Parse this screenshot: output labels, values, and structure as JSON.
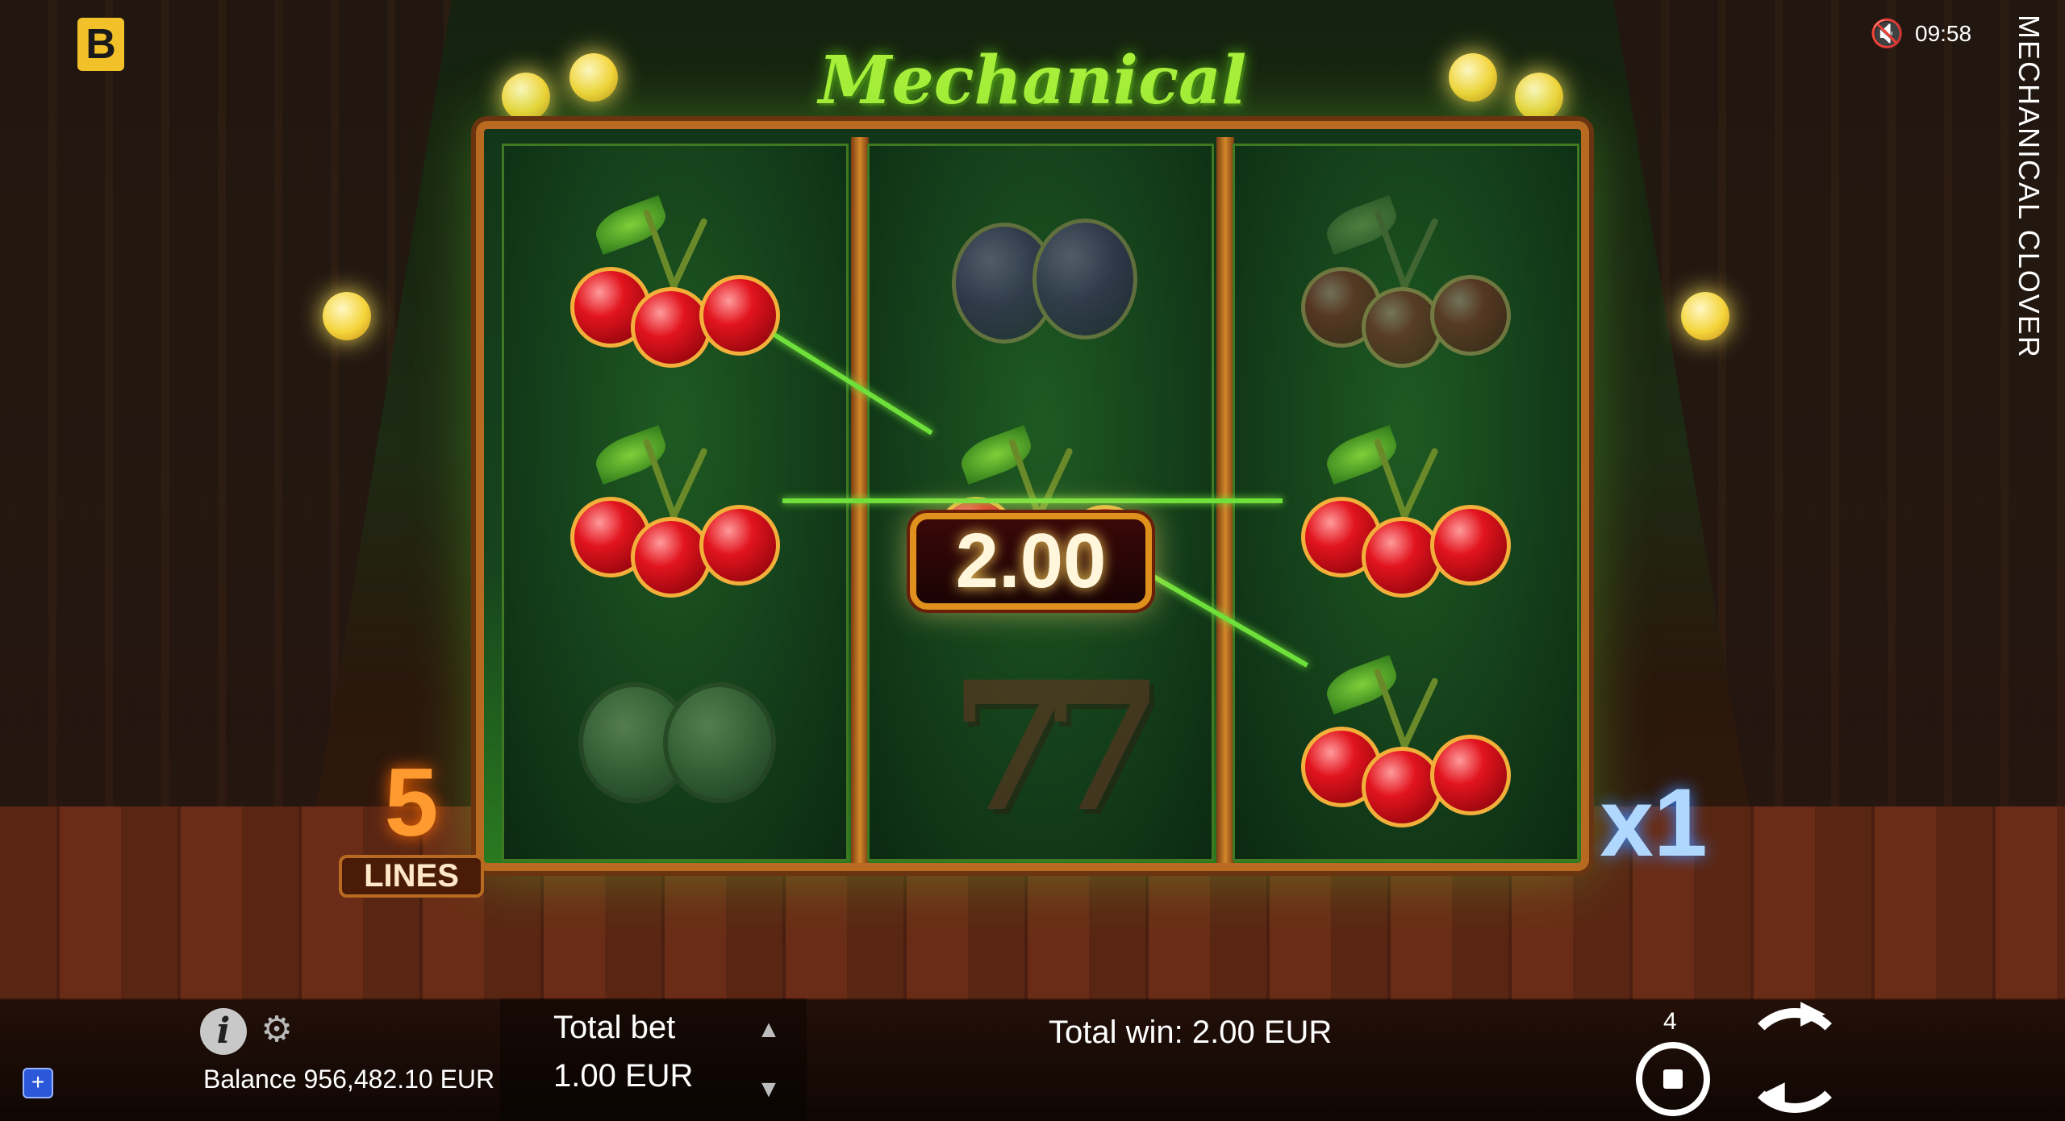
{
  "app": {
    "logo_letter": "B",
    "clock": "09:58",
    "side_title": "MECHANICAL CLOVER",
    "sound_icon": "speaker-muted-icon"
  },
  "game": {
    "title": "Mechanical Clover",
    "reels": [
      [
        "cherry",
        "cherry",
        "watermelon"
      ],
      [
        "plum",
        "cherry",
        "seven"
      ],
      [
        "cherry",
        "cherry",
        "cherry"
      ]
    ],
    "win_amount": "2.00",
    "lines_count": "5",
    "lines_label": "LINES",
    "multiplier": "x1"
  },
  "bottom_bar": {
    "balance_label": "Balance 956,482.10 EUR",
    "bet_label": "Total bet",
    "bet_value": "1.00 EUR",
    "total_win": "Total win: 2.00 EUR",
    "autoplay_count": "4",
    "plus_label": "+"
  },
  "colors": {
    "accent_green": "#6fe03a",
    "frame_gold": "#b86a20",
    "logo_yellow": "#f2c12a",
    "win_red": "#3a0808"
  }
}
